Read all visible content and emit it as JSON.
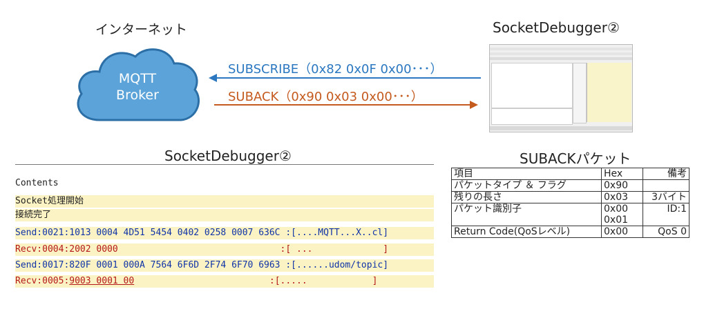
{
  "labels": {
    "internet": "インターネット",
    "socketdebugger_top": "SocketDebugger②",
    "socketdebugger_mid": "SocketDebugger②",
    "suback_packet": "SUBACKパケット"
  },
  "broker": {
    "line1": "MQTT",
    "line2": "Broker"
  },
  "arrows": {
    "subscribe": {
      "label": "SUBSCRIBE（0x82 0x0F 0x00･･･）",
      "color": "#2b78c0"
    },
    "suback": {
      "label": "SUBACK（0x90 0x03 0x00･･･）",
      "color": "#c45a1e"
    }
  },
  "log": {
    "header": "Contents",
    "start": "Socket処理開始",
    "connected": "接続完了",
    "lines": [
      {
        "prefix": "Send:0021:1013 0004 4D51 5454 0402 0258 0007 636C",
        "suffix": " :[....MQTT...X..cl]",
        "kind": "send"
      },
      {
        "prefix": "Recv:0004:2002 0000",
        "suffix": "                              :[ ...             ]",
        "kind": "recv"
      },
      {
        "prefix": "Send:0017:820F 0001 000A 7564 6F6D 2F74 6F70 6963",
        "suffix": " :[......udom/topic]",
        "kind": "send"
      },
      {
        "prefix": "Recv:0005:",
        "underlined": "9003 0001 00",
        "suffix": "                         :[.....            ]",
        "kind": "recv"
      }
    ]
  },
  "table": {
    "headers": [
      "項目",
      "Hex",
      "備考"
    ],
    "rows": [
      [
        "パケットタイプ ＆ フラグ",
        "0x90",
        ""
      ],
      [
        "残りの長さ",
        "0x03",
        "3バイト"
      ],
      [
        "パケット識別子",
        "0x00\n0x01",
        "ID:1"
      ],
      [
        "Return Code(QoSレベル)",
        "0x00",
        "QoS 0"
      ]
    ]
  }
}
